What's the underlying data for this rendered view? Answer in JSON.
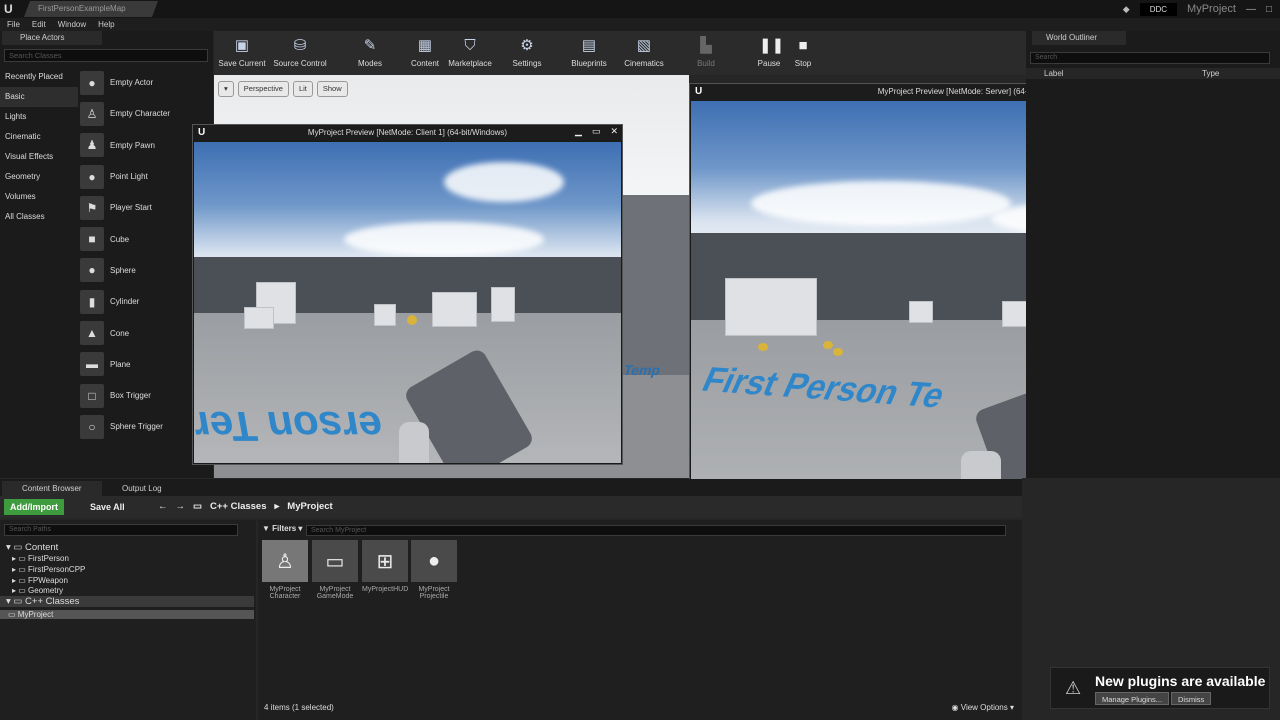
{
  "titlebar": {
    "map_tab": "FirstPersonExampleMap",
    "ddc": "DDC",
    "project": "MyProject"
  },
  "menu": [
    "File",
    "Edit",
    "Window",
    "Help"
  ],
  "place_actors": {
    "tab": "Place Actors",
    "search_placeholder": "Search Classes",
    "categories": [
      "Recently Placed",
      "Basic",
      "Lights",
      "Cinematic",
      "Visual Effects",
      "Geometry",
      "Volumes",
      "All Classes"
    ],
    "actors": [
      "Empty Actor",
      "Empty Character",
      "Empty Pawn",
      "Point Light",
      "Player Start",
      "Cube",
      "Sphere",
      "Cylinder",
      "Cone",
      "Plane",
      "Box Trigger",
      "Sphere Trigger"
    ]
  },
  "toolbar": [
    "Save Current",
    "Source Control",
    "Modes",
    "Content",
    "Marketplace",
    "Settings",
    "Blueprints",
    "Cinematics",
    "Build",
    "Pause",
    "Stop"
  ],
  "viewport": {
    "perspective": "Perspective",
    "lit": "Lit",
    "show": "Show",
    "floor_text": "Temp"
  },
  "client_window": {
    "title": "MyProject Preview [NetMode: Client 1]  (64-bit/Windows)",
    "floor_text": "erson Ter"
  },
  "server_window": {
    "title": "MyProject Preview [NetMode: Server]  (64-bit/Windows)",
    "floor_text": "First Person Te"
  },
  "outliner": {
    "tab": "World Outliner",
    "search": "Search",
    "col_label": "Label",
    "col_type": "Type"
  },
  "content_browser": {
    "tab1": "Content Browser",
    "tab2": "Output Log",
    "add_import": "Add/Import",
    "save_all": "Save All",
    "crumb1": "C++ Classes",
    "crumb2": "MyProject",
    "path_search": "Search Paths",
    "tree": [
      "Content",
      "FirstPerson",
      "FirstPersonCPP",
      "FPWeapon",
      "Geometry",
      "C++ Classes",
      "MyProject"
    ],
    "filters": "Filters",
    "asset_search": "Search MyProject",
    "assets": [
      "MyProject Character",
      "MyProject GameMode",
      "MyProjectHUD",
      "MyProject Projectile"
    ],
    "count": "4 items (1 selected)",
    "view_options": "View Options"
  },
  "notification": {
    "title": "New plugins are available",
    "manage": "Manage Plugins...",
    "dismiss": "Dismiss"
  }
}
